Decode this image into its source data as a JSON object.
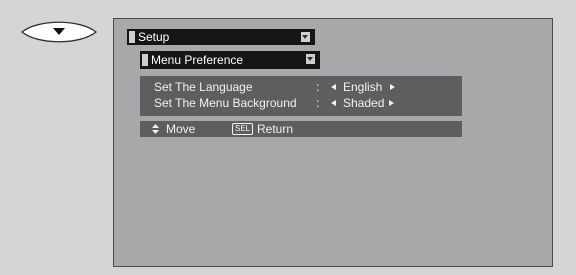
{
  "remote": {
    "icon": "down-arrow-button-icon"
  },
  "menu": {
    "title": "Setup",
    "submenu": "Menu Preference"
  },
  "options": [
    {
      "label": "Set The Language",
      "value": "English"
    },
    {
      "label": "Set The Menu Background",
      "value": "Shaded"
    }
  ],
  "status_bar": {
    "move_label": "Move",
    "sel_key": "SEL",
    "return_label": "Return"
  },
  "colors": {
    "bar": "#151515",
    "panel": "#5e5e5f",
    "screen": "#a8a8aa",
    "background": "#d5d5d5"
  }
}
